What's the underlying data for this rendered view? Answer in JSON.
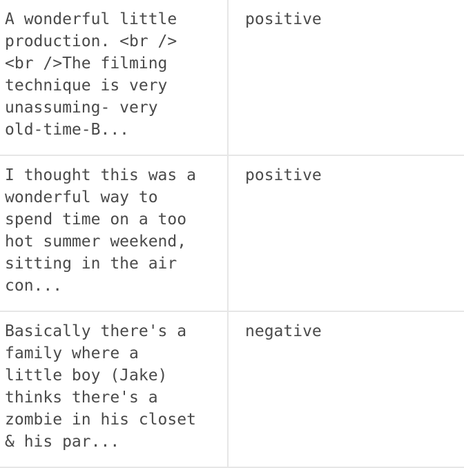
{
  "rows": [
    {
      "review": "A wonderful little\nproduction. <br />\n<br />The filming\ntechnique is very\nunassuming- very\nold-time-B...",
      "sentiment": "positive"
    },
    {
      "review": "I thought this was a\nwonderful way to\nspend time on a too\nhot summer weekend,\nsitting in the air\ncon...",
      "sentiment": "positive"
    },
    {
      "review": "Basically there's a\nfamily where a\nlittle boy (Jake)\nthinks there's a\nzombie in his closet\n& his par...",
      "sentiment": "negative"
    }
  ]
}
